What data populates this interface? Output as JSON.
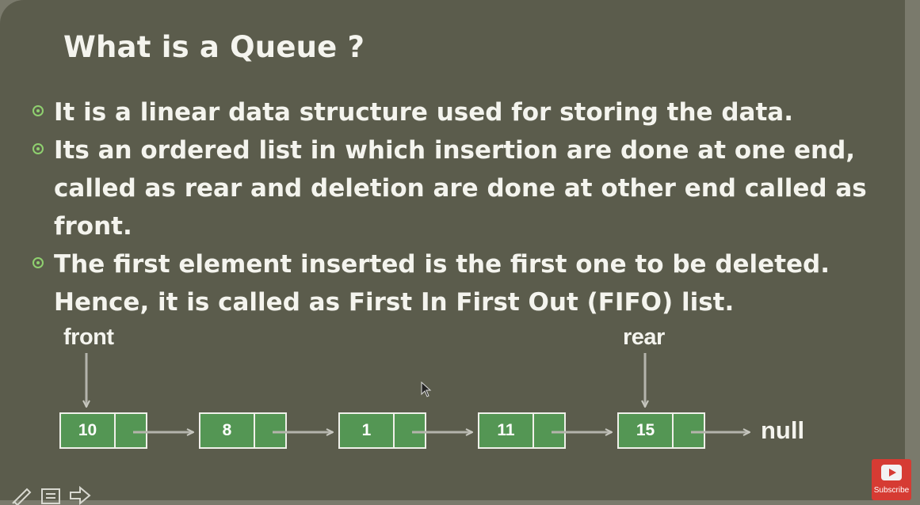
{
  "slide": {
    "title": "What is a Queue ?",
    "bullets": [
      {
        "lines": [
          "It is a linear data structure used for storing the data."
        ]
      },
      {
        "lines": [
          "Its an ordered list in which insertion are done at one end,",
          "called as rear and deletion are done at other end called as",
          "front."
        ]
      },
      {
        "lines": [
          "The first element inserted is the first one to be deleted.",
          "Hence, it is called as First In First Out (FIFO) list."
        ]
      }
    ],
    "diagram": {
      "front_label": "front",
      "rear_label": "rear",
      "nodes": [
        "10",
        "8",
        "1",
        "11",
        "15"
      ],
      "terminal_label": "null"
    }
  },
  "colors": {
    "slide_background": "#5b5c4c",
    "node_fill": "#549654",
    "bullet_accent": "#8fd06f",
    "arrow": "#b4b4ac"
  },
  "toolbar": {
    "icons": [
      "pen-icon",
      "notes-icon",
      "next-arrow-icon"
    ]
  },
  "youtube": {
    "subscribe_label": "Subscribe",
    "icon": "youtube-play-icon"
  }
}
